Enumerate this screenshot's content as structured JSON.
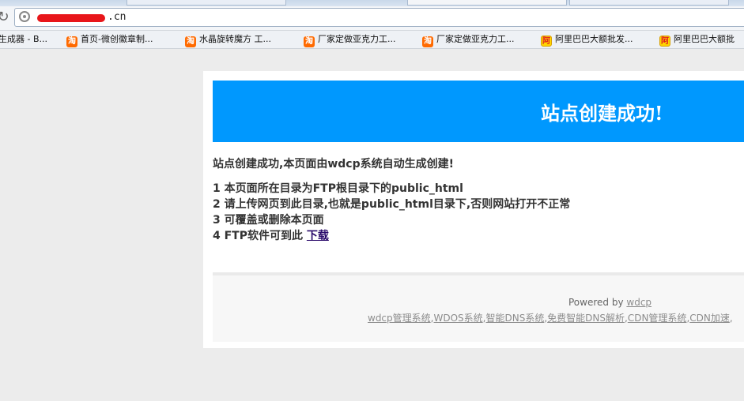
{
  "browser": {
    "address": {
      "url_suffix": ".cn"
    },
    "bookmarks": [
      {
        "icon": "page-icon",
        "label": "生成器 - B..."
      },
      {
        "icon": "taobao-icon",
        "label": "首页-微创徽章制..."
      },
      {
        "icon": "taobao-icon",
        "label": "水晶旋转魔方 工..."
      },
      {
        "icon": "taobao-icon",
        "label": "厂家定做亚克力工..."
      },
      {
        "icon": "taobao-icon",
        "label": "厂家定做亚克力工..."
      },
      {
        "icon": "alibaba-icon",
        "label": "阿里巴巴大额批发..."
      },
      {
        "icon": "alibaba-icon",
        "label": "阿里巴巴大额批"
      }
    ]
  },
  "page": {
    "banner_title": "站点创建成功!",
    "intro": "站点创建成功,本页面由wdcp系统自动生成创建!",
    "steps": [
      "1 本页面所在目录为FTP根目录下的public_html",
      "2 请上传网页到此目录,也就是public_html目录下,否则网站打开不正常",
      "3 可覆盖或删除本页面",
      "4 FTP软件可到此"
    ],
    "download_link": "下载",
    "footer": {
      "powered_by": "Powered by",
      "powered_link": "wdcp",
      "links": [
        "wdcp管理系统",
        "WDOS系统",
        "智能DNS系统",
        "免费智能DNS解析",
        "CDN管理系统",
        "CDN加速"
      ],
      "separator": ",",
      "trailing": ","
    }
  },
  "colors": {
    "banner": "#0098fe",
    "tab_glyph": "淘",
    "ali_glyph": "阿"
  }
}
